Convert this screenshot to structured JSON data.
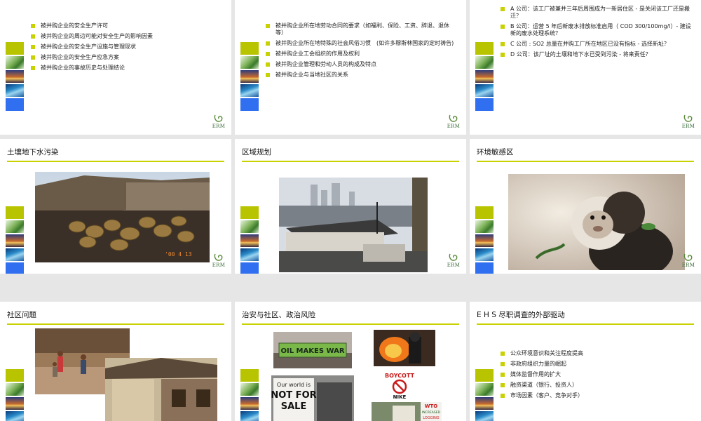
{
  "brand": "ERM",
  "slides": {
    "s1": {
      "bullets": [
        "被并购企业的安全生产许可",
        "被并购企业的周边可能对安全生产的影响因素",
        "被并购企业的安全生产设施与管理现状",
        "被并购企业的安全生产应急方案",
        "被并购企业的事故历史与处理结论"
      ]
    },
    "s2": {
      "bullets": [
        "被并购企业所在地劳动合同的要求（如福利、保险、工资、辞退、退休等）",
        "被并购企业所在地特殊的社会风俗习惯　(如许多穆斯林国家的定时祷告)",
        "被并购企业工会组织的作用及权利",
        "被并购企业管理和劳动人员的构成及特点",
        "被并购企业与当地社区的关系"
      ]
    },
    "s3": {
      "bullets": [
        "A 公司：该工厂被兼并三年后周围成为一新居住区 - 是关闭该工厂还是搬迁？",
        "B 公司：运营 5 年后新废水排放标准启用（ COD 300/100mg/l）- 建设新的废水处理系统？",
        "C 公司 : SO2 总量在并购工厂所在地区已没有指标 - 选择新址？",
        "D 公司：该厂址的土壤和地下水已受到污染 - 将来责任？"
      ]
    },
    "s4": {
      "title": "土壤地下水污染",
      "photo_stamp": "'00  4  13"
    },
    "s5": {
      "title": "区域规划"
    },
    "s6": {
      "title": "环境敏感区"
    },
    "s7": {
      "title": "社区问题"
    },
    "s8": {
      "title": "治安与社区、政治风险",
      "banner_text": "OIL MAKES WAR",
      "poster_text": [
        "Our world is",
        "NOT FOR",
        "SALE"
      ],
      "boycott_text": [
        "BOYCOTT",
        "NIKE"
      ],
      "wto_text": [
        "WTO",
        "INCREASED",
        "LOGGING"
      ]
    },
    "s9": {
      "title": "E H S 尽职调查的外部驱动",
      "bullets": [
        "公众环境意识和关注程度提高",
        "非政府组织力量的崛起",
        "媒体监督作用的扩大",
        "融资渠道（银行、投资人）",
        "市场因素（客户、竞争对手）"
      ]
    }
  },
  "colors": {
    "accent": "#c8d200",
    "strip_blue": "#2f6ff0",
    "erm_green": "#3a6a3a"
  },
  "icons": {
    "logo": "erm-swirl-icon"
  }
}
